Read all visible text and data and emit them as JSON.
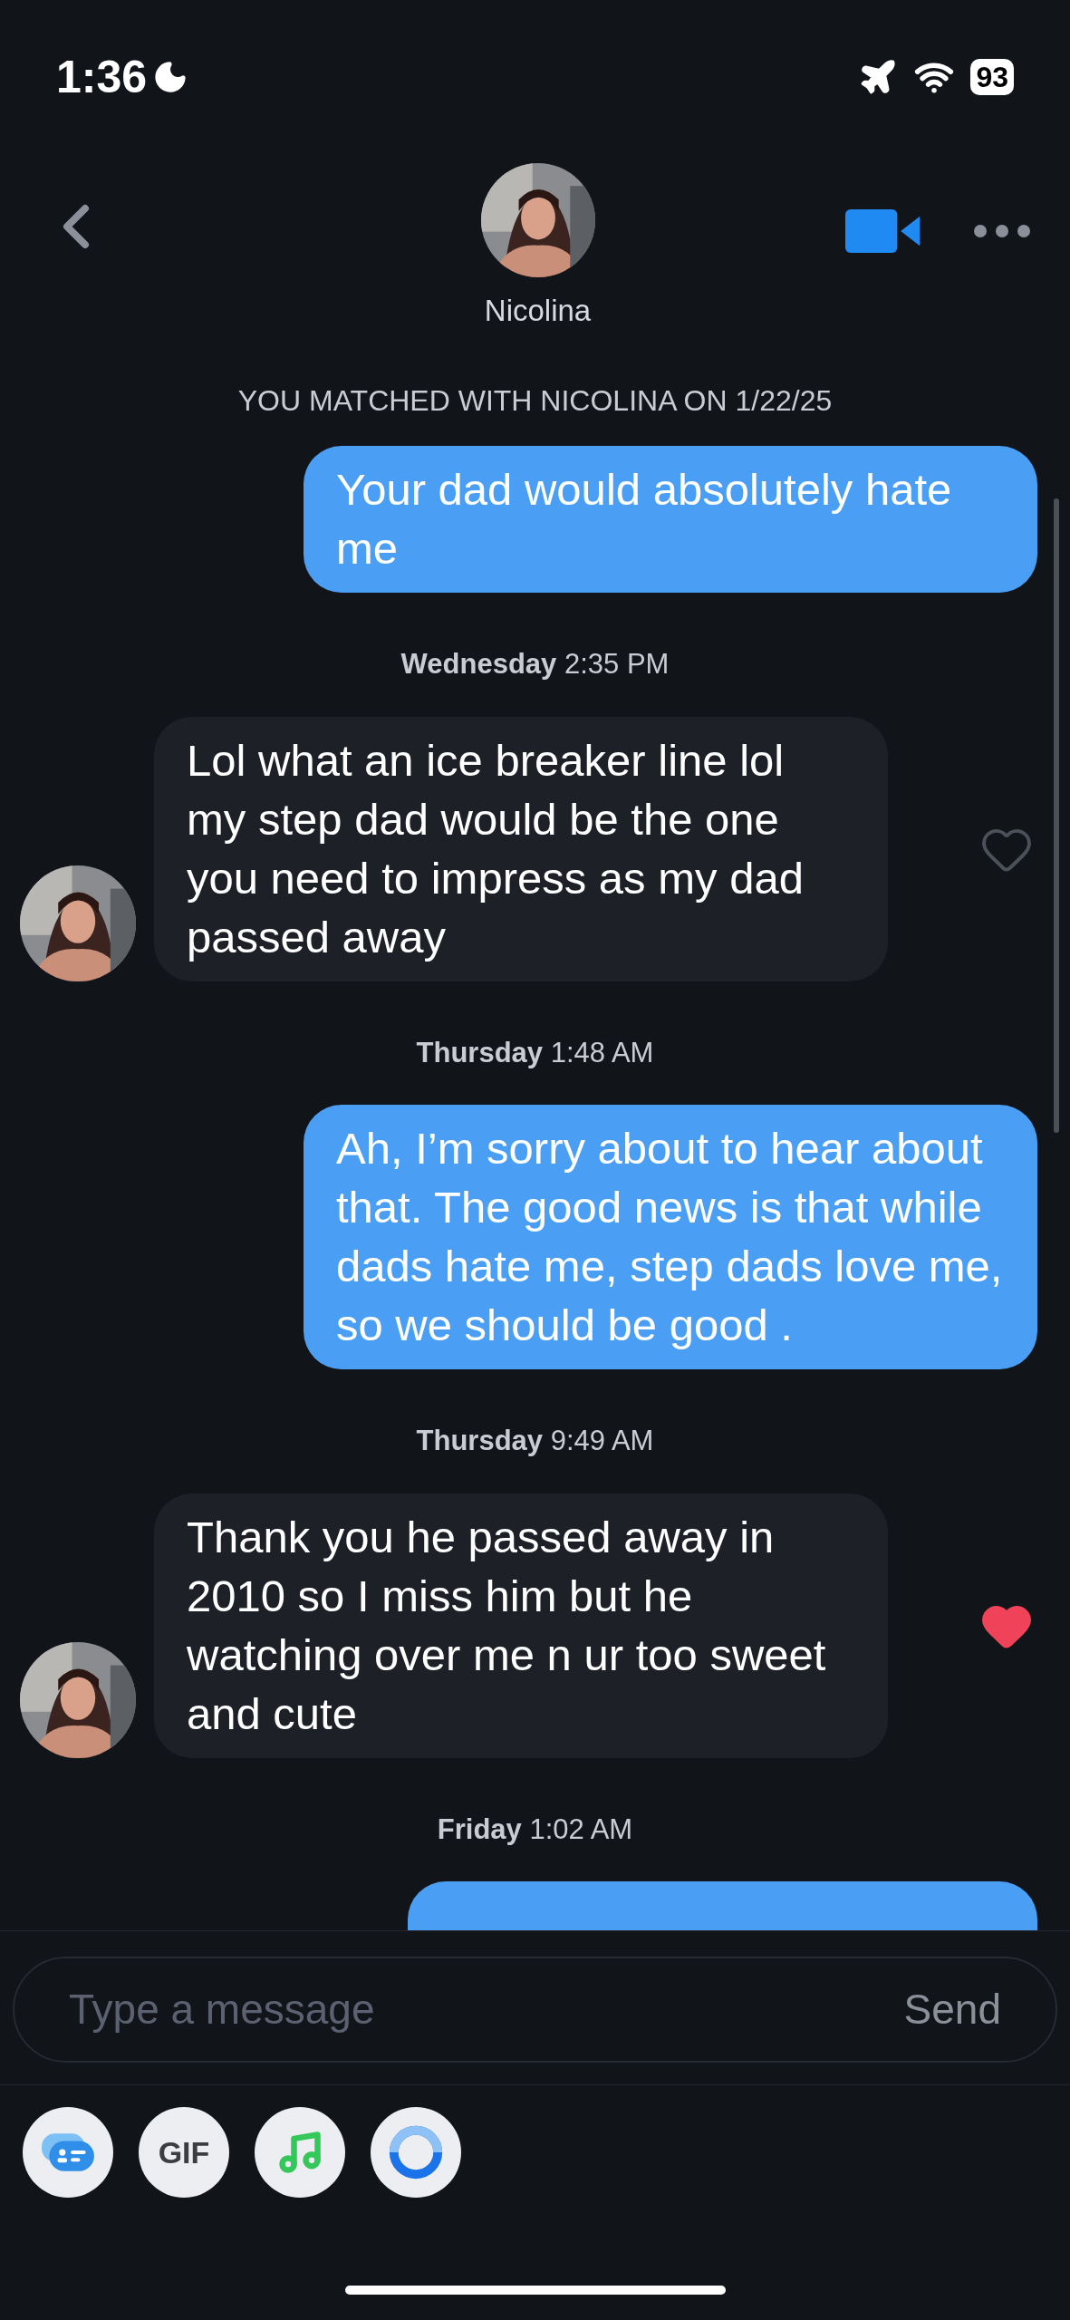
{
  "status_bar": {
    "time": "1:36",
    "battery": "93"
  },
  "header": {
    "name": "Nicolina"
  },
  "match_notice": "YOU MATCHED WITH NICOLINA ON 1/22/25",
  "messages": [
    {
      "kind": "sent",
      "text": "Your dad would absolutely hate me"
    },
    {
      "kind": "timestamp",
      "text": "**Wednesday** 2:35 PM"
    },
    {
      "kind": "received",
      "text": "Lol what an ice breaker line lol my step dad would be the one you need to impress as my dad passed away",
      "liked": false
    },
    {
      "kind": "timestamp",
      "text": "**Thursday** 1:48 AM"
    },
    {
      "kind": "sent",
      "text": "Ah, I’m sorry about to hear about that. The good news is that while dads hate me, step dads love me, so we should be good ."
    },
    {
      "kind": "timestamp",
      "text": "**Thursday** 9:49 AM"
    },
    {
      "kind": "received",
      "text": "Thank you he passed away in 2010 so I miss him but he watching over me n ur too sweet and cute",
      "liked": true
    },
    {
      "kind": "timestamp",
      "text": "**Friday** 1:02 AM"
    },
    {
      "kind": "sent_partial"
    }
  ],
  "composer": {
    "placeholder": "Type a message",
    "send": "Send"
  },
  "toolbar": [
    {
      "kind": "card"
    },
    {
      "kind": "gif",
      "label": "GIF"
    },
    {
      "kind": "music"
    },
    {
      "kind": "ring"
    }
  ]
}
